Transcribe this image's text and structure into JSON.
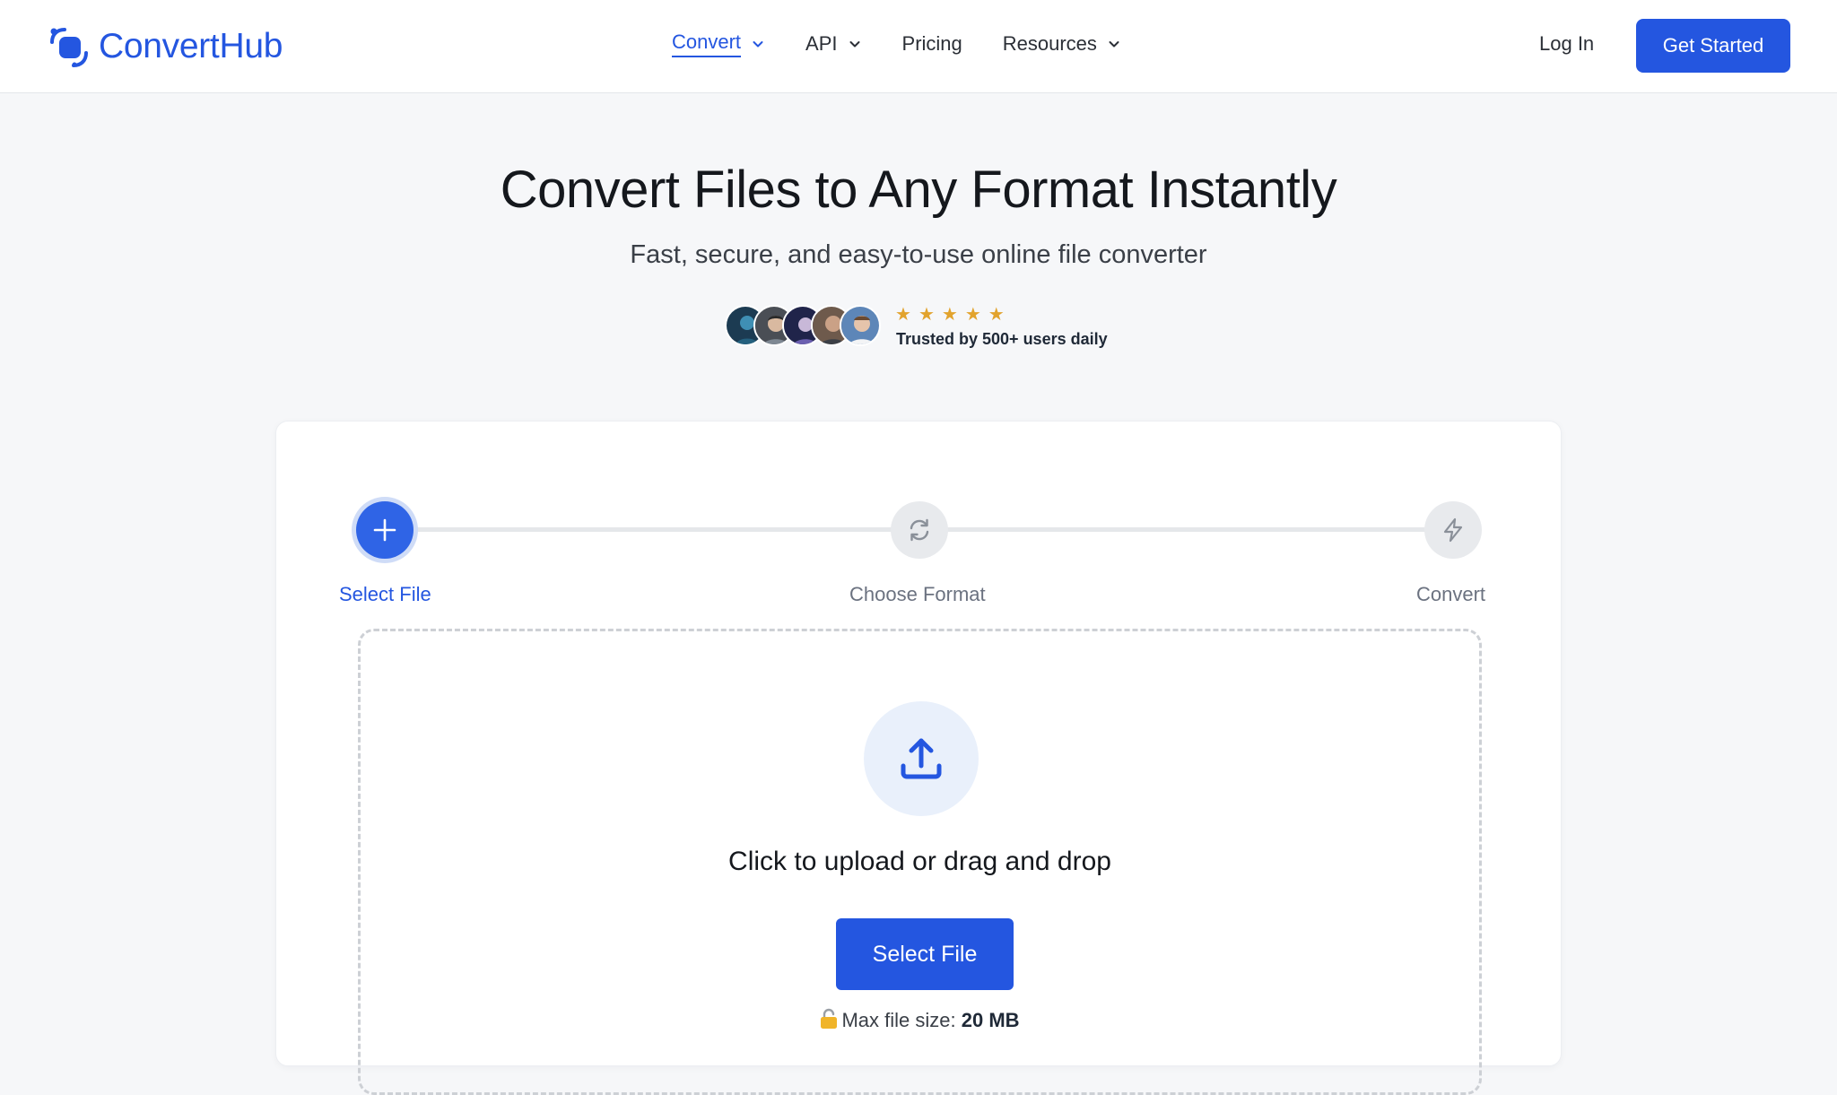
{
  "brand": {
    "name": "ConvertHub",
    "logo_icon": "converthub-logo-icon",
    "accent": "#2456e0"
  },
  "nav": {
    "items": [
      {
        "label": "Convert",
        "has_dropdown": true,
        "active": true
      },
      {
        "label": "API",
        "has_dropdown": true,
        "active": false
      },
      {
        "label": "Pricing",
        "has_dropdown": false,
        "active": false
      },
      {
        "label": "Resources",
        "has_dropdown": true,
        "active": false
      }
    ],
    "login_label": "Log In",
    "cta_label": "Get Started"
  },
  "hero": {
    "title": "Convert Files to Any Format Instantly",
    "subtitle": "Fast, secure, and easy-to-use online file converter",
    "rating": {
      "stars": 5,
      "star_color": "#e2a32d",
      "trust_text": "Trusted by 500+ users daily"
    },
    "avatar_count": 5
  },
  "stepper": {
    "steps": [
      {
        "label": "Select File",
        "icon": "plus-icon",
        "state": "active"
      },
      {
        "label": "Choose Format",
        "icon": "refresh-icon",
        "state": "pending"
      },
      {
        "label": "Convert",
        "icon": "lightning-icon",
        "state": "pending"
      }
    ]
  },
  "upload": {
    "icon": "upload-icon",
    "prompt": "Click to upload or drag and drop",
    "button_label": "Select File",
    "max_size_label": "Max file size:",
    "max_size_value": "20 MB",
    "lock_icon": "lock-icon"
  }
}
